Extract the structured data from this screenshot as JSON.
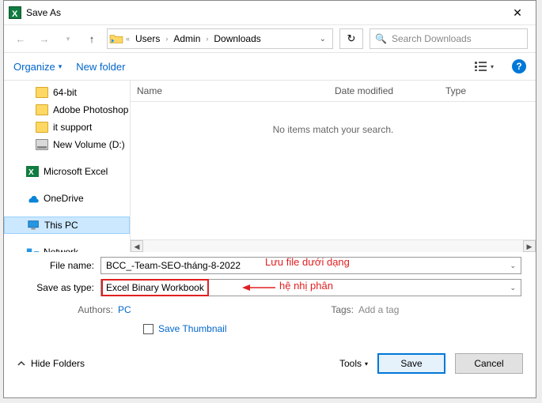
{
  "title": "Save As",
  "crumbs": {
    "a": "Users",
    "b": "Admin",
    "c": "Downloads"
  },
  "search_ph": "Search Downloads",
  "toolbar": {
    "organize": "Organize",
    "newfolder": "New folder"
  },
  "cols": {
    "name": "Name",
    "date": "Date modified",
    "type": "Type"
  },
  "empty": "No items match your search.",
  "tree": {
    "f64": "64-bit",
    "ps": "Adobe Photoshop",
    "it": "it support",
    "nv": "New Volume (D:)",
    "xl": "Microsoft Excel",
    "od": "OneDrive",
    "pc": "This PC",
    "net": "Network"
  },
  "form": {
    "fname_lbl": "File name:",
    "fname_val": "BCC_-Team-SEO-tháng-8-2022",
    "type_lbl": "Save as type:",
    "type_val": "Excel Binary Workbook",
    "authors_lbl": "Authors:",
    "authors_val": "PC",
    "tags_lbl": "Tags:",
    "tags_ph": "Add a tag",
    "thumb": "Save Thumbnail"
  },
  "ann": {
    "a": "Lưu file dưới dạng",
    "b": "hệ nhị phân"
  },
  "footer": {
    "hide": "Hide Folders",
    "tools": "Tools",
    "save": "Save",
    "cancel": "Cancel"
  }
}
